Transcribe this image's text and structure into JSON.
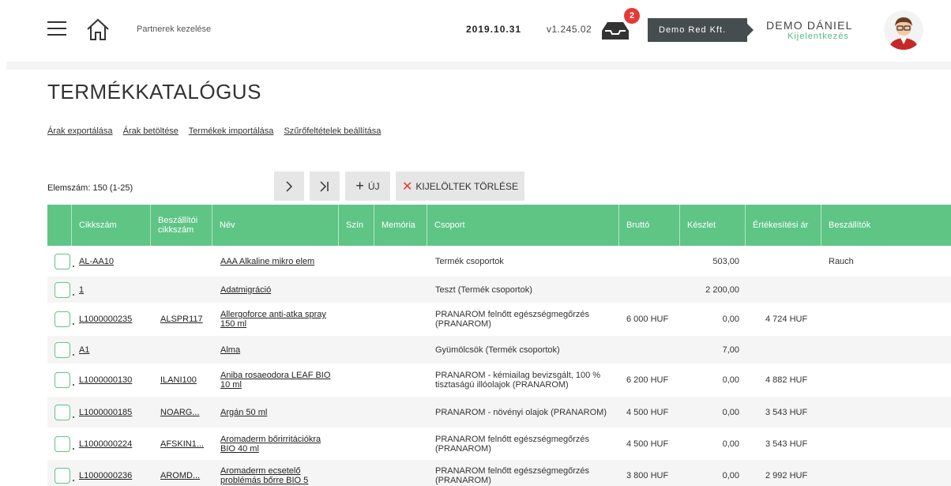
{
  "header": {
    "breadcrumb": "Partnerek kezelése",
    "date": "2019.10.31",
    "version": "v1.245.02",
    "notification_count": "2",
    "company": "Demo Red Kft.",
    "user_name": "DEMO DÁNIEL",
    "logout": "Kijelentkezés"
  },
  "page": {
    "title": "TERMÉKKATALÓGUS",
    "links": [
      "Árak exportálása",
      "Árak betöltése",
      "Termékek importálása",
      "Szűrőfeltételek beállítása"
    ],
    "count": "Elemszám: 150 (1-25)"
  },
  "toolbar": {
    "next": "›",
    "last": "›|",
    "new_label": "ÚJ",
    "delete_label": "KIJELÖLTEK TÖRLÉSE"
  },
  "table": {
    "columns": [
      "Cikkszám",
      "Beszállítói cikkszám",
      "Név",
      "Szín",
      "Memória",
      "Csoport",
      "Bruttó",
      "Készlet",
      "Értékesítési ár",
      "Beszállítók"
    ],
    "rows": [
      {
        "sku": "AL-AA10",
        "supplier_sku": "",
        "name": "AAA Alkaline mikro elem",
        "color": "",
        "memory": "",
        "group": "Termék csoportok",
        "gross": "",
        "stock": "503,00",
        "price": "",
        "suppliers": "Rauch"
      },
      {
        "sku": "1",
        "supplier_sku": "",
        "name": "Adatmigráció",
        "color": "",
        "memory": "",
        "group": "Teszt (Termék csoportok)",
        "gross": "",
        "stock": "2 200,00",
        "price": "",
        "suppliers": ""
      },
      {
        "sku": "L1000000235",
        "supplier_sku": "ALSPR117",
        "name": "Allergoforce anti-atka spray 150 ml",
        "color": "",
        "memory": "",
        "group": "PRANAROM felnőtt egészségmegőrzés (PRANAROM)",
        "gross": "6 000 HUF",
        "stock": "0,00",
        "price": "4 724 HUF",
        "suppliers": ""
      },
      {
        "sku": "A1",
        "supplier_sku": "",
        "name": "Alma",
        "color": "",
        "memory": "",
        "group": "Gyümölcsök (Termék csoportok)",
        "gross": "",
        "stock": "7,00",
        "price": "",
        "suppliers": ""
      },
      {
        "sku": "L1000000130",
        "supplier_sku": "ILANI100",
        "name": "Aniba rosaeodora LEAF BIO 10 ml",
        "color": "",
        "memory": "",
        "group": "PRANAROM - kémiailag bevizsgált, 100 % tisztaságú illóolajok (PRANAROM)",
        "gross": "6 200 HUF",
        "stock": "0,00",
        "price": "4 882 HUF",
        "suppliers": ""
      },
      {
        "sku": "L1000000185",
        "supplier_sku": "NOARG...",
        "name": "Argán 50 ml",
        "color": "",
        "memory": "",
        "group": "PRANAROM - növényi olajok (PRANAROM)",
        "gross": "4 500 HUF",
        "stock": "0,00",
        "price": "3 543 HUF",
        "suppliers": ""
      },
      {
        "sku": "L1000000224",
        "supplier_sku": "AFSKIN1...",
        "name": "Aromaderm bőrirritációkra BIO 40 ml",
        "color": "",
        "memory": "",
        "group": "PRANAROM felnőtt egészségmegőrzés (PRANAROM)",
        "gross": "4 500 HUF",
        "stock": "0,00",
        "price": "3 543 HUF",
        "suppliers": ""
      },
      {
        "sku": "L1000000236",
        "supplier_sku": "AROMD...",
        "name": "Aromaderm ecsetelő problémás bőrre BIO 5",
        "color": "",
        "memory": "",
        "group": "PRANAROM felnőtt egészségmegőrzés (PRANAROM)",
        "gross": "3 800 HUF",
        "stock": "0,00",
        "price": "2 992 HUF",
        "suppliers": ""
      }
    ]
  },
  "colors": {
    "accent": "#5ec585",
    "badge": "#e53935",
    "company_bg": "#454d4f"
  }
}
